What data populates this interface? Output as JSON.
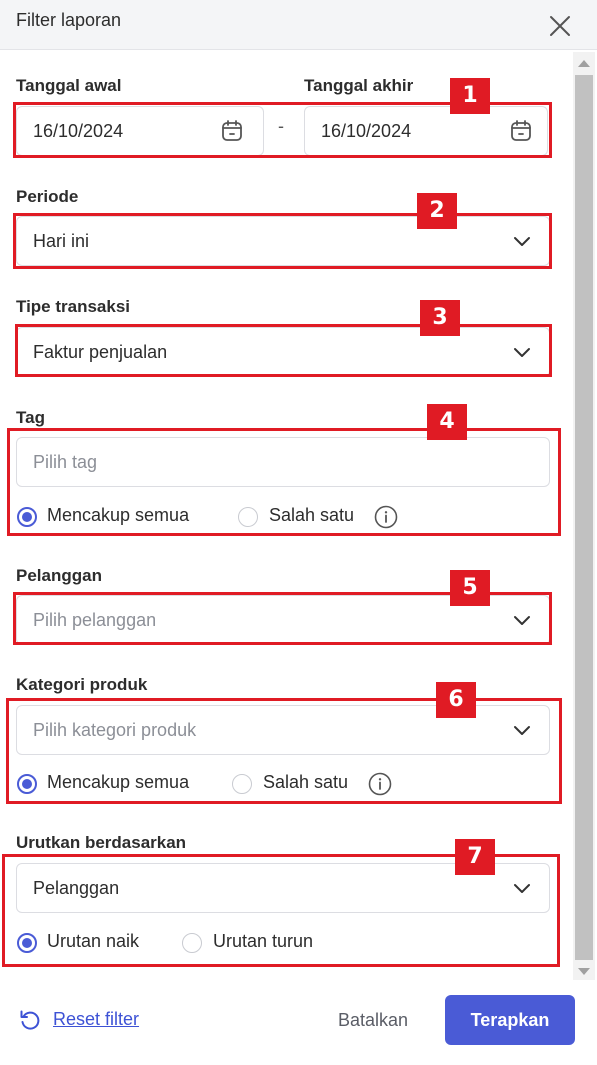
{
  "header": {
    "title": "Filter laporan"
  },
  "date": {
    "start_label": "Tanggal awal",
    "end_label": "Tanggal akhir",
    "start_value": "16/10/2024",
    "end_value": "16/10/2024",
    "separator": "-"
  },
  "period": {
    "label": "Periode",
    "value": "Hari ini"
  },
  "transaction_type": {
    "label": "Tipe transaksi",
    "value": "Faktur penjualan"
  },
  "tag": {
    "label": "Tag",
    "placeholder": "Pilih tag",
    "options": [
      "Mencakup semua",
      "Salah satu"
    ],
    "selected": "Mencakup semua"
  },
  "customer": {
    "label": "Pelanggan",
    "placeholder": "Pilih pelanggan"
  },
  "product_category": {
    "label": "Kategori produk",
    "placeholder": "Pilih kategori produk",
    "options": [
      "Mencakup semua",
      "Salah satu"
    ],
    "selected": "Mencakup semua"
  },
  "sort": {
    "label": "Urutkan berdasarkan",
    "value": "Pelanggan",
    "options": [
      "Urutan naik",
      "Urutan turun"
    ],
    "selected": "Urutan naik"
  },
  "annotations": [
    "1",
    "2",
    "3",
    "4",
    "5",
    "6",
    "7"
  ],
  "footer": {
    "reset_label": "Reset filter",
    "cancel_label": "Batalkan",
    "apply_label": "Terapkan"
  },
  "colors": {
    "accent": "#4a5bd6",
    "annotation": "#e01b24",
    "header_bg": "#f4f5f7"
  }
}
